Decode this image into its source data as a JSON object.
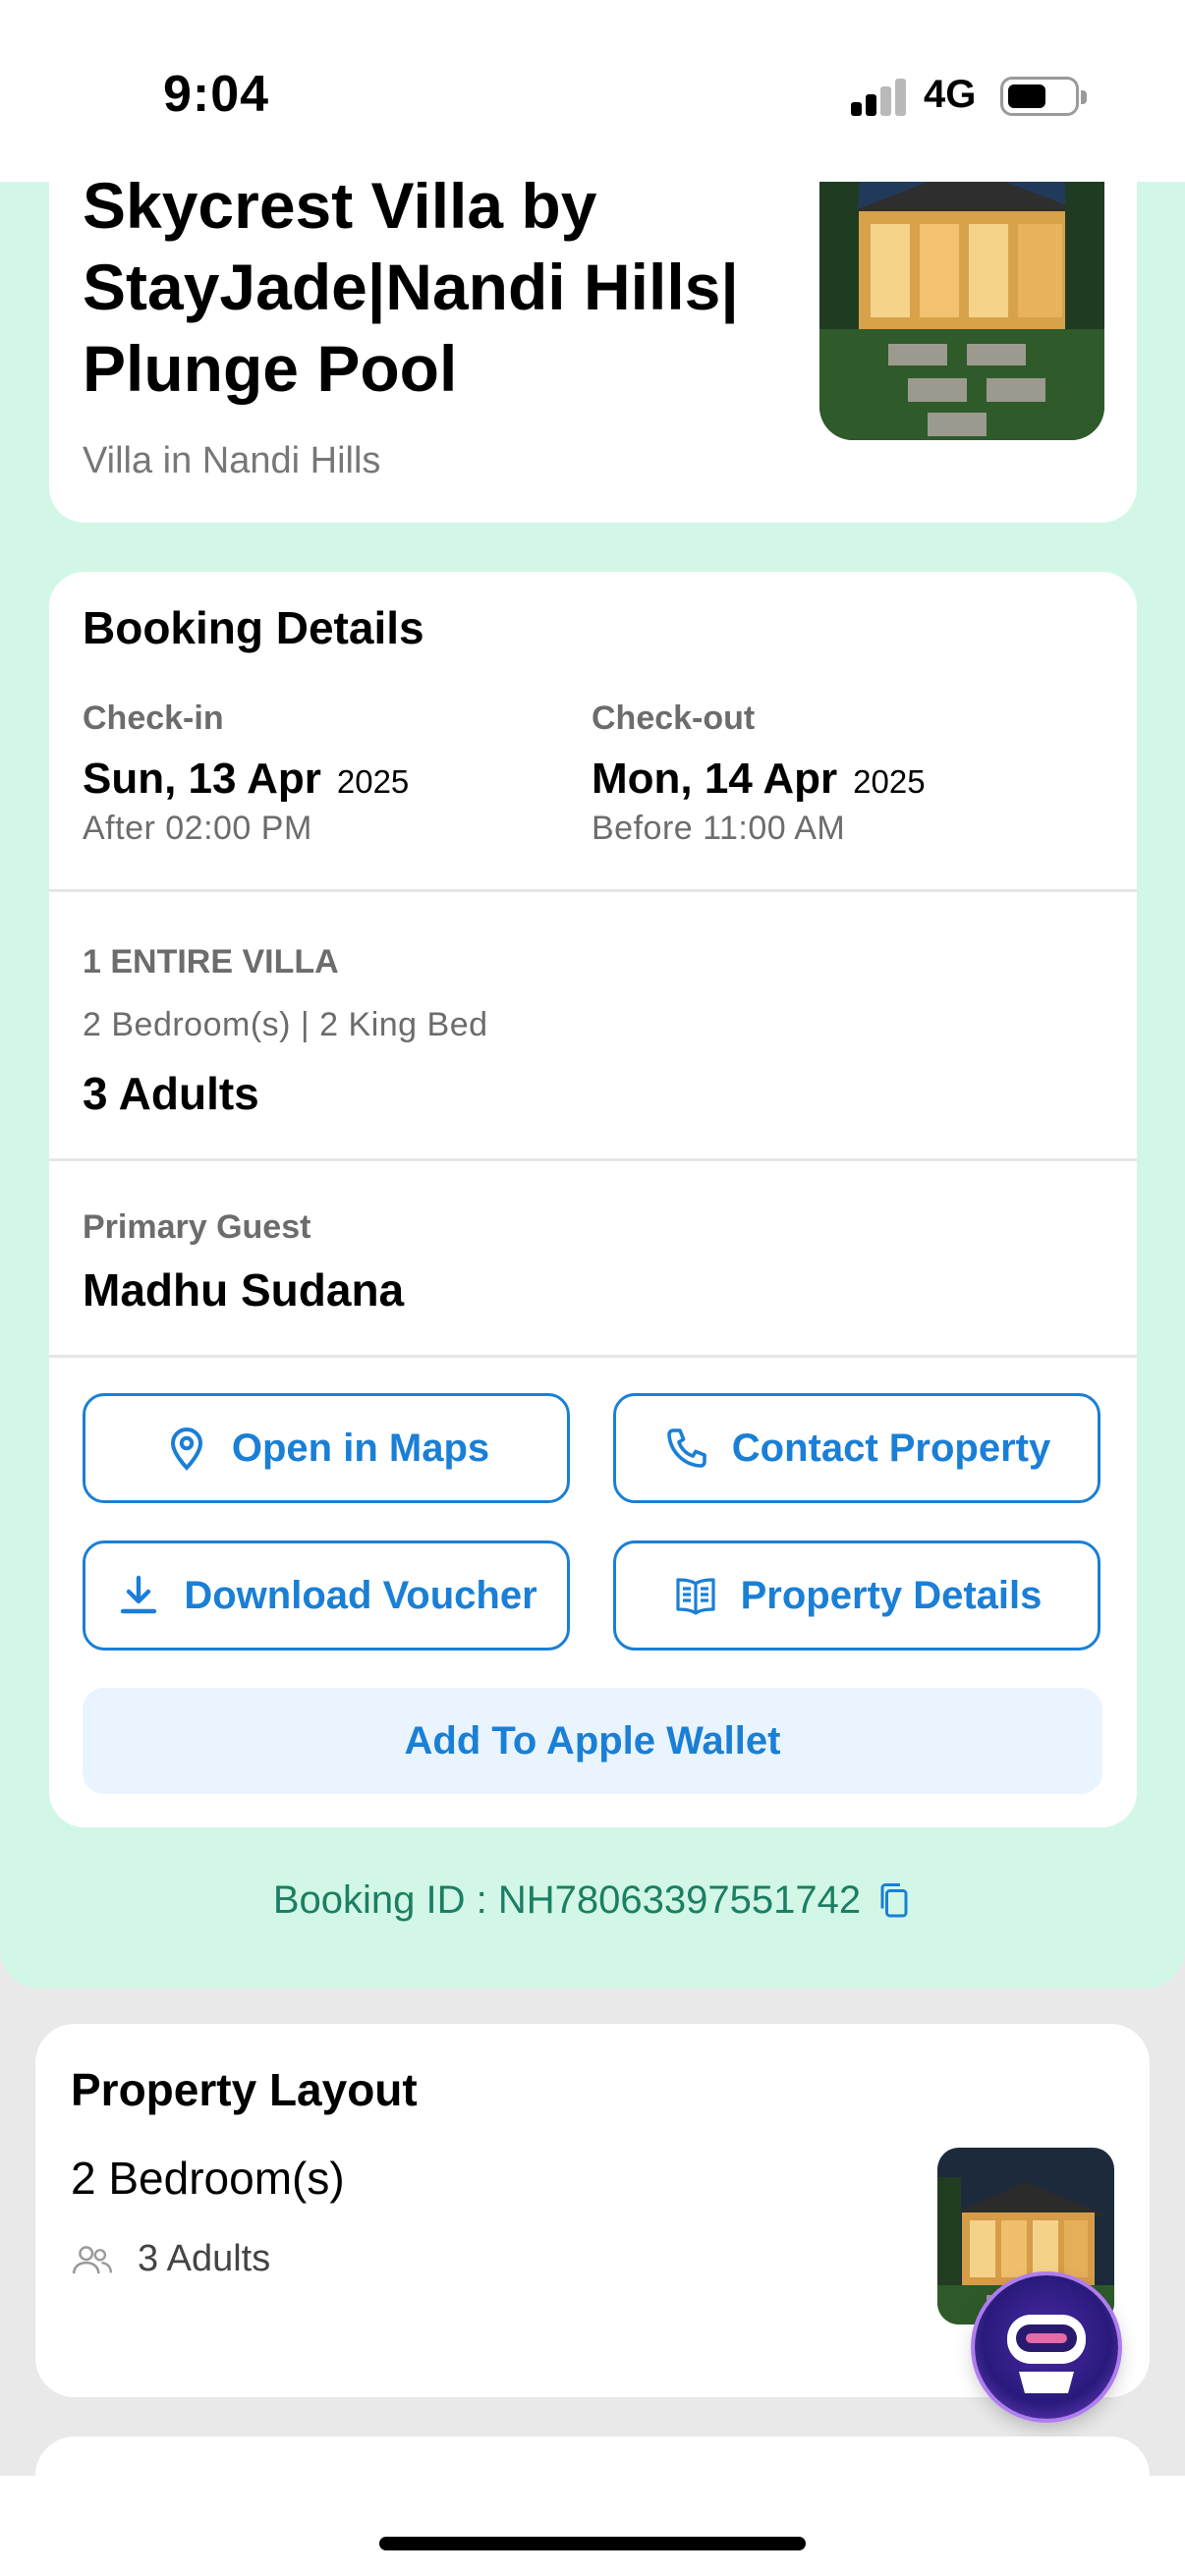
{
  "status_bar": {
    "time": "9:04",
    "network": "4G",
    "signal_bars": 2,
    "battery_level": 0.55
  },
  "hotel": {
    "title": "Skycrest Villa by StayJade|Nandi Hills| Plunge Pool",
    "subtitle": "Villa in Nandi Hills",
    "image_icon": "villa-photo"
  },
  "booking": {
    "title": "Booking Details",
    "checkin": {
      "label": "Check-in",
      "date": "Sun, 13 Apr",
      "year": "2025",
      "time": "After  02:00 PM"
    },
    "checkout": {
      "label": "Check-out",
      "date": "Mon, 14 Apr",
      "year": "2025",
      "time": "Before  11:00 AM"
    },
    "unit": "1 ENTIRE VILLA",
    "beds": "2 Bedroom(s) | 2 King Bed",
    "guests": "3 Adults",
    "primary_guest_label": "Primary Guest",
    "primary_guest_name": "Madhu  Sudana",
    "actions": {
      "maps": "Open in Maps",
      "contact": "Contact Property",
      "voucher": "Download Voucher",
      "details": "Property Details",
      "wallet": "Add To Apple Wallet"
    },
    "booking_id": "Booking ID : NH78063397551742"
  },
  "layout": {
    "title": "Property Layout",
    "rooms": "2 Bedroom(s)",
    "adults": "3 Adults"
  },
  "colors": {
    "accent": "#1a7fd6",
    "mint": "#d3f7e7",
    "booking_id": "#1b7f62"
  }
}
